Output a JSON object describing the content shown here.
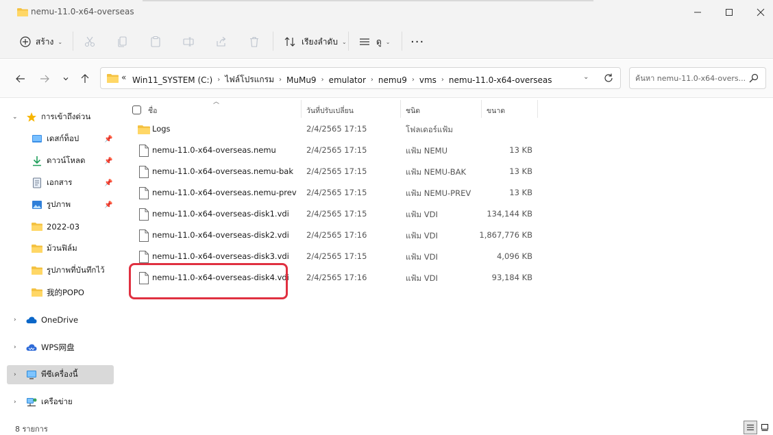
{
  "window": {
    "title": "nemu-11.0-x64-overseas",
    "minimize": "—",
    "maximize": "☐",
    "close": "✕"
  },
  "toolbar": {
    "new_label": "สร้าง",
    "sort_label": "เรียงลำดับ",
    "view_label": "ดู",
    "more_label": "···"
  },
  "address": {
    "lead": "«",
    "crumbs": [
      "Win11_SYSTEM (C:)",
      "ไฟล์โปรแกรม",
      "MuMu9",
      "emulator",
      "nemu9",
      "vms",
      "nemu-11.0-x64-overseas"
    ],
    "separator": "›"
  },
  "search": {
    "placeholder": "ค้นหา nemu-11.0-x64-overs..."
  },
  "sidebar": {
    "quick_access": "การเข้าถึงด่วน",
    "items": [
      {
        "label": "เดสก์ท็อป",
        "pinned": true
      },
      {
        "label": "ดาวน์โหลด",
        "pinned": true
      },
      {
        "label": "เอกสาร",
        "pinned": true
      },
      {
        "label": "รูปภาพ",
        "pinned": true
      },
      {
        "label": "2022-03",
        "pinned": false
      },
      {
        "label": "ม้วนฟิล์ม",
        "pinned": false
      },
      {
        "label": "รูปภาพที่บันทึกไว้",
        "pinned": false
      },
      {
        "label": "我的POPO",
        "pinned": false
      }
    ],
    "onedrive": "OneDrive",
    "wps": "WPS网盘",
    "this_pc": "พีซีเครื่องนี้",
    "network": "เครือข่าย"
  },
  "columns": {
    "name": "ชื่อ",
    "date": "วันที่ปรับเปลี่ยน",
    "type": "ชนิด",
    "size": "ขนาด"
  },
  "files": [
    {
      "name": "Logs",
      "date": "2/4/2565 17:15",
      "type": "โฟลเดอร์แฟ้ม",
      "size": "",
      "kind": "folder"
    },
    {
      "name": "nemu-11.0-x64-overseas.nemu",
      "date": "2/4/2565 17:15",
      "type": "แฟ้ม NEMU",
      "size": "13 KB",
      "kind": "file"
    },
    {
      "name": "nemu-11.0-x64-overseas.nemu-bak",
      "date": "2/4/2565 17:15",
      "type": "แฟ้ม NEMU-BAK",
      "size": "13 KB",
      "kind": "file"
    },
    {
      "name": "nemu-11.0-x64-overseas.nemu-prev",
      "date": "2/4/2565 17:15",
      "type": "แฟ้ม NEMU-PREV",
      "size": "13 KB",
      "kind": "file"
    },
    {
      "name": "nemu-11.0-x64-overseas-disk1.vdi",
      "date": "2/4/2565 17:15",
      "type": "แฟ้ม VDI",
      "size": "134,144 KB",
      "kind": "file"
    },
    {
      "name": "nemu-11.0-x64-overseas-disk2.vdi",
      "date": "2/4/2565 17:16",
      "type": "แฟ้ม VDI",
      "size": "1,867,776 KB",
      "kind": "file"
    },
    {
      "name": "nemu-11.0-x64-overseas-disk3.vdi",
      "date": "2/4/2565 17:15",
      "type": "แฟ้ม VDI",
      "size": "4,096 KB",
      "kind": "file"
    },
    {
      "name": "nemu-11.0-x64-overseas-disk4.vdi",
      "date": "2/4/2565 17:16",
      "type": "แฟ้ม VDI",
      "size": "93,184 KB",
      "kind": "file"
    }
  ],
  "status": {
    "count": "8 รายการ"
  },
  "colors": {
    "highlight": "#e03040",
    "folder": "#f4c242",
    "accent": "#0067c0"
  }
}
